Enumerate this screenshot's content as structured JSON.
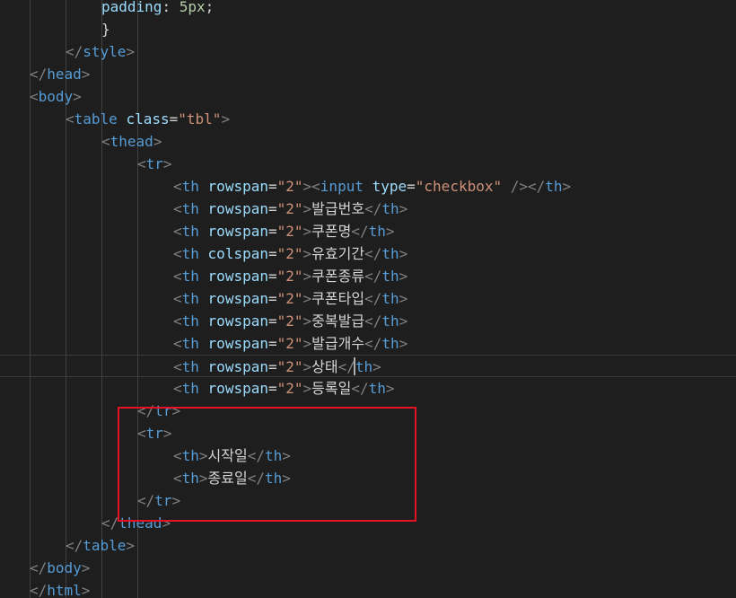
{
  "editor": {
    "language": "html",
    "colors": {
      "background": "#1e1e1e",
      "tag": "#569cd6",
      "punctuation": "#808080",
      "attribute": "#9cdcfe",
      "string": "#ce9178",
      "text": "#d4d4d4",
      "number": "#b5cea8",
      "highlight_box": "#e81123"
    },
    "current_line": 16,
    "annotation": {
      "type": "red-rectangle",
      "label": "",
      "first_line": 17,
      "last_line": 21
    },
    "lines": [
      {
        "indent": 2,
        "tokens": [
          [
            "prop",
            "padding"
          ],
          [
            "text",
            ": "
          ],
          [
            "num",
            "5px"
          ],
          [
            "text",
            ";"
          ]
        ]
      },
      {
        "indent": 2,
        "tokens": [
          [
            "text",
            "}"
          ]
        ]
      },
      {
        "indent": 1,
        "tokens": [
          [
            "punct",
            "</"
          ],
          [
            "tag",
            "style"
          ],
          [
            "punct",
            ">"
          ]
        ]
      },
      {
        "indent": 0,
        "tokens": [
          [
            "punct",
            "</"
          ],
          [
            "tag",
            "head"
          ],
          [
            "punct",
            ">"
          ]
        ]
      },
      {
        "indent": 0,
        "tokens": [
          [
            "punct",
            "<"
          ],
          [
            "tag",
            "body"
          ],
          [
            "punct",
            ">"
          ]
        ]
      },
      {
        "indent": 1,
        "tokens": [
          [
            "punct",
            "<"
          ],
          [
            "tag",
            "table"
          ],
          [
            "text",
            " "
          ],
          [
            "attr",
            "class"
          ],
          [
            "text",
            "="
          ],
          [
            "str",
            "\"tbl\""
          ],
          [
            "punct",
            ">"
          ]
        ]
      },
      {
        "indent": 2,
        "tokens": [
          [
            "punct",
            "<"
          ],
          [
            "tag",
            "thead"
          ],
          [
            "punct",
            ">"
          ]
        ]
      },
      {
        "indent": 3,
        "tokens": [
          [
            "punct",
            "<"
          ],
          [
            "tag",
            "tr"
          ],
          [
            "punct",
            ">"
          ]
        ]
      },
      {
        "indent": 4,
        "tokens": [
          [
            "punct",
            "<"
          ],
          [
            "tag",
            "th"
          ],
          [
            "text",
            " "
          ],
          [
            "attr",
            "rowspan"
          ],
          [
            "text",
            "="
          ],
          [
            "str",
            "\"2\""
          ],
          [
            "punct",
            "><"
          ],
          [
            "tag",
            "input"
          ],
          [
            "text",
            " "
          ],
          [
            "attr",
            "type"
          ],
          [
            "text",
            "="
          ],
          [
            "str",
            "\"checkbox\""
          ],
          [
            "text",
            " "
          ],
          [
            "punct",
            "/></"
          ],
          [
            "tag",
            "th"
          ],
          [
            "punct",
            ">"
          ]
        ]
      },
      {
        "indent": 4,
        "tokens": [
          [
            "punct",
            "<"
          ],
          [
            "tag",
            "th"
          ],
          [
            "text",
            " "
          ],
          [
            "attr",
            "rowspan"
          ],
          [
            "text",
            "="
          ],
          [
            "str",
            "\"2\""
          ],
          [
            "punct",
            ">"
          ],
          [
            "text",
            "발급번호"
          ],
          [
            "punct",
            "</"
          ],
          [
            "tag",
            "th"
          ],
          [
            "punct",
            ">"
          ]
        ]
      },
      {
        "indent": 4,
        "tokens": [
          [
            "punct",
            "<"
          ],
          [
            "tag",
            "th"
          ],
          [
            "text",
            " "
          ],
          [
            "attr",
            "rowspan"
          ],
          [
            "text",
            "="
          ],
          [
            "str",
            "\"2\""
          ],
          [
            "punct",
            ">"
          ],
          [
            "text",
            "쿠폰명"
          ],
          [
            "punct",
            "</"
          ],
          [
            "tag",
            "th"
          ],
          [
            "punct",
            ">"
          ]
        ]
      },
      {
        "indent": 4,
        "tokens": [
          [
            "punct",
            "<"
          ],
          [
            "tag",
            "th"
          ],
          [
            "text",
            " "
          ],
          [
            "attr",
            "colspan"
          ],
          [
            "text",
            "="
          ],
          [
            "str",
            "\"2\""
          ],
          [
            "punct",
            ">"
          ],
          [
            "text",
            "유효기간"
          ],
          [
            "punct",
            "</"
          ],
          [
            "tag",
            "th"
          ],
          [
            "punct",
            ">"
          ]
        ]
      },
      {
        "indent": 4,
        "tokens": [
          [
            "punct",
            "<"
          ],
          [
            "tag",
            "th"
          ],
          [
            "text",
            " "
          ],
          [
            "attr",
            "rowspan"
          ],
          [
            "text",
            "="
          ],
          [
            "str",
            "\"2\""
          ],
          [
            "punct",
            ">"
          ],
          [
            "text",
            "쿠폰종류"
          ],
          [
            "punct",
            "</"
          ],
          [
            "tag",
            "th"
          ],
          [
            "punct",
            ">"
          ]
        ]
      },
      {
        "indent": 4,
        "tokens": [
          [
            "punct",
            "<"
          ],
          [
            "tag",
            "th"
          ],
          [
            "text",
            " "
          ],
          [
            "attr",
            "rowspan"
          ],
          [
            "text",
            "="
          ],
          [
            "str",
            "\"2\""
          ],
          [
            "punct",
            ">"
          ],
          [
            "text",
            "쿠폰타입"
          ],
          [
            "punct",
            "</"
          ],
          [
            "tag",
            "th"
          ],
          [
            "punct",
            ">"
          ]
        ]
      },
      {
        "indent": 4,
        "tokens": [
          [
            "punct",
            "<"
          ],
          [
            "tag",
            "th"
          ],
          [
            "text",
            " "
          ],
          [
            "attr",
            "rowspan"
          ],
          [
            "text",
            "="
          ],
          [
            "str",
            "\"2\""
          ],
          [
            "punct",
            ">"
          ],
          [
            "text",
            "중복발급"
          ],
          [
            "punct",
            "</"
          ],
          [
            "tag",
            "th"
          ],
          [
            "punct",
            ">"
          ]
        ]
      },
      {
        "indent": 4,
        "tokens": [
          [
            "punct",
            "<"
          ],
          [
            "tag",
            "th"
          ],
          [
            "text",
            " "
          ],
          [
            "attr",
            "rowspan"
          ],
          [
            "text",
            "="
          ],
          [
            "str",
            "\"2\""
          ],
          [
            "punct",
            ">"
          ],
          [
            "text",
            "발급개수"
          ],
          [
            "punct",
            "</"
          ],
          [
            "tag",
            "th"
          ],
          [
            "punct",
            ">"
          ]
        ]
      },
      {
        "indent": 4,
        "tokens": [
          [
            "punct",
            "<"
          ],
          [
            "tag",
            "th"
          ],
          [
            "text",
            " "
          ],
          [
            "attr",
            "rowspan"
          ],
          [
            "text",
            "="
          ],
          [
            "str",
            "\"2\""
          ],
          [
            "punct",
            ">"
          ],
          [
            "text",
            "상태"
          ],
          [
            "punct",
            "</"
          ],
          [
            "tag",
            "th"
          ],
          [
            "punct",
            ">"
          ]
        ]
      },
      {
        "indent": 4,
        "tokens": [
          [
            "punct",
            "<"
          ],
          [
            "tag",
            "th"
          ],
          [
            "text",
            " "
          ],
          [
            "attr",
            "rowspan"
          ],
          [
            "text",
            "="
          ],
          [
            "str",
            "\"2\""
          ],
          [
            "punct",
            ">"
          ],
          [
            "text",
            "등록일"
          ],
          [
            "punct",
            "</"
          ],
          [
            "tag",
            "th"
          ],
          [
            "punct",
            ">"
          ]
        ]
      },
      {
        "indent": 3,
        "tokens": [
          [
            "punct",
            "</"
          ],
          [
            "tag",
            "tr"
          ],
          [
            "punct",
            ">"
          ]
        ]
      },
      {
        "indent": 3,
        "tokens": [
          [
            "punct",
            "<"
          ],
          [
            "tag",
            "tr"
          ],
          [
            "punct",
            ">"
          ]
        ]
      },
      {
        "indent": 4,
        "tokens": [
          [
            "punct",
            "<"
          ],
          [
            "tag",
            "th"
          ],
          [
            "punct",
            ">"
          ],
          [
            "text",
            "시작일"
          ],
          [
            "punct",
            "</"
          ],
          [
            "tag",
            "th"
          ],
          [
            "punct",
            ">"
          ]
        ]
      },
      {
        "indent": 4,
        "tokens": [
          [
            "punct",
            "<"
          ],
          [
            "tag",
            "th"
          ],
          [
            "punct",
            ">"
          ],
          [
            "text",
            "종료일"
          ],
          [
            "punct",
            "</"
          ],
          [
            "tag",
            "th"
          ],
          [
            "punct",
            ">"
          ]
        ]
      },
      {
        "indent": 3,
        "tokens": [
          [
            "punct",
            "</"
          ],
          [
            "tag",
            "tr"
          ],
          [
            "punct",
            ">"
          ]
        ]
      },
      {
        "indent": 2,
        "tokens": [
          [
            "punct",
            "</"
          ],
          [
            "tag",
            "thead"
          ],
          [
            "punct",
            ">"
          ]
        ]
      },
      {
        "indent": 1,
        "tokens": [
          [
            "punct",
            "</"
          ],
          [
            "tag",
            "table"
          ],
          [
            "punct",
            ">"
          ]
        ]
      },
      {
        "indent": 0,
        "tokens": [
          [
            "punct",
            "</"
          ],
          [
            "tag",
            "body"
          ],
          [
            "punct",
            ">"
          ]
        ]
      },
      {
        "indent": 0,
        "tokens": [
          [
            "punct",
            "</"
          ],
          [
            "tag",
            "html"
          ],
          [
            "punct",
            ">"
          ]
        ]
      }
    ]
  }
}
